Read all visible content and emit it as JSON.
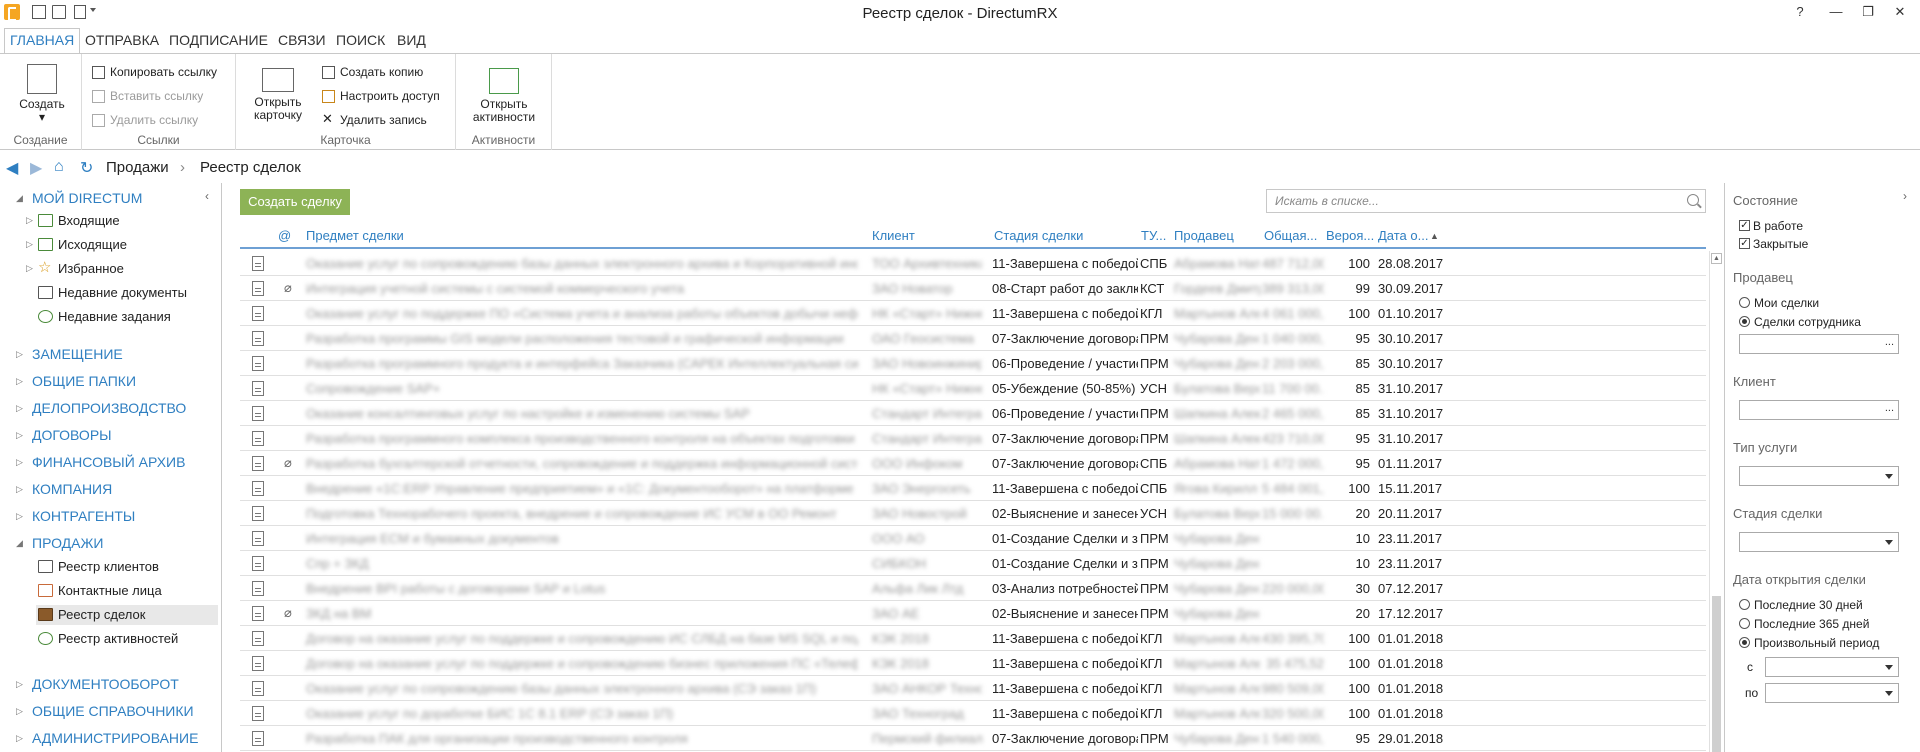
{
  "window": {
    "title": "Реестр сделок - DirectumRX",
    "help": "?",
    "minimize": "—",
    "restore": "❐",
    "close": "✕"
  },
  "ribbon": {
    "tabs": [
      "ГЛАВНАЯ",
      "ОТПРАВКА",
      "ПОДПИСАНИЕ",
      "СВЯЗИ",
      "ПОИСК",
      "ВИД"
    ],
    "groups": {
      "create": {
        "label": "Создание",
        "create_btn": "Создать",
        "create_caret": "▾"
      },
      "links": {
        "label": "Ссылки",
        "copy": "Копировать ссылку",
        "paste": "Вставить ссылку",
        "delete": "Удалить ссылку"
      },
      "card": {
        "label": "Карточка",
        "open1": "Открыть",
        "open2": "карточку",
        "copy": "Создать копию",
        "access": "Настроить доступ",
        "delete": "Удалить запись"
      },
      "activity": {
        "label": "Активности",
        "open1": "Открыть",
        "open2": "активности"
      }
    }
  },
  "nav": {
    "breadcrumb_sep": "›",
    "crumb1": "Продажи",
    "crumb2": "Реестр сделок"
  },
  "sidebar": {
    "my": "МОЙ DIRECTUM",
    "my_items": [
      "Входящие",
      "Исходящие",
      "Избранное",
      "Недавние документы",
      "Недавние задания"
    ],
    "sections_top": [
      "ЗАМЕЩЕНИЕ",
      "ОБЩИЕ ПАПКИ",
      "ДЕЛОПРОИЗВОДСТВО",
      "ДОГОВОРЫ",
      "ФИНАНСОВЫЙ АРХИВ",
      "КОМПАНИЯ",
      "КОНТРАГЕНТЫ"
    ],
    "sales": "ПРОДАЖИ",
    "sales_items": [
      "Реестр клиентов",
      "Контактные лица",
      "Реестр сделок",
      "Реестр активностей"
    ],
    "sections_bottom": [
      "ДОКУМЕНТООБОРОТ",
      "ОБЩИЕ СПРАВОЧНИКИ",
      "АДМИНИСТРИРОВАНИЕ"
    ]
  },
  "main": {
    "create_deal": "Создать сделку",
    "search_placeholder": "Искать в списке...",
    "columns": {
      "at": "@",
      "subject": "Предмет сделки",
      "client": "Клиент",
      "stage": "Стадия сделки",
      "tu": "ТУ...",
      "seller": "Продавец",
      "total": "Общая...",
      "prob": "Вероя...",
      "date": "Дата о...",
      "sort": "▲"
    },
    "rows": [
      {
        "clip": false,
        "subject": "Оказание услуг по сопровождению базы данных электронного архива и Корпоративной информационной системы",
        "client": "ТОО Архивтехника",
        "stage": "11-Завершена с победой (...",
        "tu": "СПБ",
        "seller": "Абрамова Ната...",
        "total": "487 712,00",
        "prob": "100",
        "date": "28.08.2017"
      },
      {
        "clip": true,
        "subject": "Интеграция учетной системы с системой коммерческого учета",
        "client": "ЗАО Новатор",
        "stage": "08-Старт работ до заключ...",
        "tu": "КСТ",
        "seller": "Гордеев Дмитр...",
        "total": "389 313,00",
        "prob": "99",
        "date": "30.09.2017"
      },
      {
        "clip": false,
        "subject": "Оказание услуг по поддержке ПО «Система учета и анализа работы объектов добычи нефти и газа»",
        "client": "НК «Старт» Нижне...",
        "stage": "11-Завершена с победой (...",
        "tu": "КГЛ",
        "seller": "Мартынов Алек...",
        "total": "4 061 000,...",
        "prob": "100",
        "date": "01.10.2017"
      },
      {
        "clip": false,
        "subject": "Разработка программы GIS модели расположения тестовой и графической информации",
        "client": "ОАО Геосистема",
        "stage": "07-Заключение договора (...",
        "tu": "ПРМ",
        "seller": "Чубарова Денис...",
        "total": "1 040 000,...",
        "prob": "95",
        "date": "30.10.2017"
      },
      {
        "clip": false,
        "subject": "Разработка программного продукта и интерфейса Заказчика (САРЕК Интеллектуальная система), Прод...",
        "client": "ЗАО Новоинжиниринг",
        "stage": "06-Проведение / участие в...",
        "tu": "ПРМ",
        "seller": "Чубарова Денис...",
        "total": "2 203 000,...",
        "prob": "85",
        "date": "30.10.2017"
      },
      {
        "clip": false,
        "subject": "Сопровождение SAP+",
        "client": "НК «Старт» Нижне...",
        "stage": "05-Убеждение (50-85%)",
        "tu": "УСН",
        "seller": "Булатова Верон...",
        "total": "11 700 00...",
        "prob": "85",
        "date": "31.10.2017"
      },
      {
        "clip": false,
        "subject": "Оказание консалтинговых услуг по настройке и изменению системы SAP",
        "client": "Стандарт Интеграц...",
        "stage": "06-Проведение / участие в...",
        "tu": "ПРМ",
        "seller": "Шапкина Алекс...",
        "total": "2 465 000,...",
        "prob": "85",
        "date": "31.10.2017"
      },
      {
        "clip": false,
        "subject": "Разработка программного комплекса производственного контроля на объектах подготовки нефти и автомато...",
        "client": "Стандарт Интеграц...",
        "stage": "07-Заключение договора (...",
        "tu": "ПРМ",
        "seller": "Шапкина Алекс...",
        "total": "423 710,00",
        "prob": "95",
        "date": "31.10.2017"
      },
      {
        "clip": true,
        "subject": "Разработка бухгалтерской отчетности, сопровождение и поддержка информационной системы на базе типовой...",
        "client": "ООО Инфоком",
        "stage": "07-Заключение договора (...",
        "tu": "СПБ",
        "seller": "Абрамова Ната...",
        "total": "1 472 000,...",
        "prob": "95",
        "date": "01.11.2017"
      },
      {
        "clip": false,
        "subject": "Внедрение «1С:ERP Управление предприятием» и «1С: Документооборот» на платформе 1С Предприятие 8.3",
        "client": "ЗАО Энергосеть",
        "stage": "11-Завершена с победой (...",
        "tu": "СПБ",
        "seller": "Ягова Кирилл Н...",
        "total": "5 484 001,...",
        "prob": "100",
        "date": "15.11.2017"
      },
      {
        "clip": false,
        "subject": "Подготовка Технорабочего проекта, внедрение и сопровождение ИС УСМ в ОО Ремонт",
        "client": "ЗАО Новострой",
        "stage": "02-Выяснение и занесение...",
        "tu": "УСН",
        "seller": "Булатова Верон...",
        "total": "15 000 00...",
        "prob": "20",
        "date": "20.11.2017"
      },
      {
        "clip": false,
        "subject": "Интеграция ECM и бумажных документов",
        "client": "ООО АО",
        "stage": "01-Создание Сделки и зап...",
        "tu": "ПРМ",
        "seller": "Чубарова Денис...",
        "total": "",
        "prob": "10",
        "date": "23.11.2017"
      },
      {
        "clip": false,
        "subject": "Спр + ЗКД",
        "client": "СИБКОН",
        "stage": "01-Создание Сделки и зап...",
        "tu": "ПРМ",
        "seller": "Чубарова Денис...",
        "total": "",
        "prob": "10",
        "date": "23.11.2017"
      },
      {
        "clip": false,
        "subject": "Внедрение BPI работы с договорами SAP и Lotus",
        "client": "Альфа Лик Лтд",
        "stage": "03-Анализ потребностей (2...",
        "tu": "ПРМ",
        "seller": "Чубарова Денис...",
        "total": "220 000,00",
        "prob": "30",
        "date": "07.12.2017"
      },
      {
        "clip": true,
        "subject": "ЗКД на ВМ",
        "client": "ЗАО АЕ",
        "stage": "02-Выяснение и занесение...",
        "tu": "ПРМ",
        "seller": "Чубарова Денис...",
        "total": "",
        "prob": "20",
        "date": "17.12.2017"
      },
      {
        "clip": false,
        "subject": "Договор на оказание услуг по поддержке и сопровождению ИС СЛБД на базе MS SQL и подсистемы «SAP» н...",
        "client": "КЭК 2018",
        "stage": "11-Завершена с победой (...",
        "tu": "КГЛ",
        "seller": "Мартынов Алек...",
        "total": "430 395,70",
        "prob": "100",
        "date": "01.01.2018"
      },
      {
        "clip": false,
        "subject": "Договор на оказание услуг по поддержке и сопровождению бизнес приложения ПС «Телефонный справочник»",
        "client": "КЭК 2018",
        "stage": "11-Завершена с победой (...",
        "tu": "КГЛ",
        "seller": "Мартынов Алек...",
        "total": "35 475,52",
        "prob": "100",
        "date": "01.01.2018"
      },
      {
        "clip": false,
        "subject": "Оказание услуг по сопровождению базы данных электронного архива (СЭ заказ 1П)",
        "client": "ЗАО АНКОР Техно",
        "stage": "11-Завершена с победой (...",
        "tu": "КГЛ",
        "seller": "Мартынов Алек...",
        "total": "980 509,00",
        "prob": "100",
        "date": "01.01.2018"
      },
      {
        "clip": false,
        "subject": "Оказание услуг по доработке БИС 1С 8.1 ERP (СЭ заказ 1П)",
        "client": "ЗАО Техноград",
        "stage": "11-Завершена с победой (...",
        "tu": "КГЛ",
        "seller": "Мартынов Алек...",
        "total": "320 500,00",
        "prob": "100",
        "date": "01.01.2018"
      },
      {
        "clip": false,
        "subject": "Разработка ПАК для организации производственного контроля",
        "client": "Пермский филиал СК",
        "stage": "07-Заключение договора (...",
        "tu": "ПРМ",
        "seller": "Чубарова Денис...",
        "total": "1 540 000,...",
        "prob": "95",
        "date": "29.01.2018"
      }
    ]
  },
  "filters": {
    "state": {
      "title": "Состояние",
      "in_work": "В работе",
      "closed": "Закрытые",
      "checked": "✓"
    },
    "seller": {
      "title": "Продавец",
      "mine": "Мои сделки",
      "employee": "Сделки сотрудника"
    },
    "client": {
      "title": "Клиент"
    },
    "service": {
      "title": "Тип услуги"
    },
    "stage": {
      "title": "Стадия сделки"
    },
    "date": {
      "title": "Дата открытия сделки",
      "d30": "Последние 30 дней",
      "d365": "Последние 365 дней",
      "custom": "Произвольный период",
      "from": "с",
      "to": "по"
    },
    "dots": "..."
  }
}
